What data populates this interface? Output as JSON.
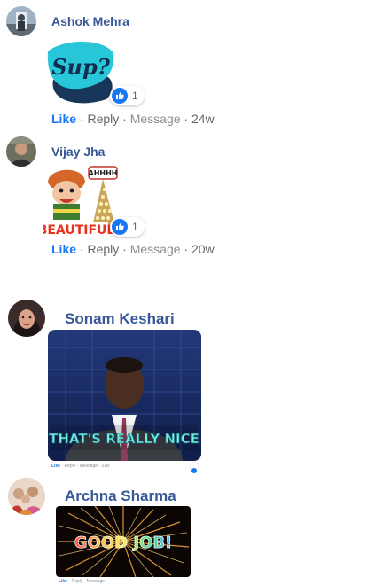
{
  "comments": [
    {
      "author": "Ashok Mehra",
      "sticker_text": "Sup?",
      "reaction_count": "1",
      "actions": {
        "like": "Like",
        "reply": "Reply",
        "message": "Message",
        "time": "24w"
      }
    },
    {
      "author": "Vijay Jha",
      "sticker_top_text": "AHHHH",
      "sticker_bottom_text": "BEAUTIFUL",
      "reaction_count": "1",
      "actions": {
        "like": "Like",
        "reply": "Reply",
        "message": "Message",
        "time": "20w"
      }
    },
    {
      "author": "Sonam Keshari",
      "gif_caption": "THAT'S REALLY NICE",
      "actions": {
        "like": "Like",
        "reply": "Reply",
        "message": "Message",
        "time": "21w"
      }
    },
    {
      "author": "Archna Sharma",
      "gif_caption": "GOOD JOB!",
      "actions": {
        "like": "Like",
        "reply": "Reply",
        "message": "Message",
        "time": ""
      }
    }
  ],
  "separator": "·",
  "colors": {
    "name": "#385898",
    "like": "#1877f2",
    "meta": "#65676b"
  },
  "icons": [
    "like-thumb-icon",
    "messenger-icon"
  ]
}
